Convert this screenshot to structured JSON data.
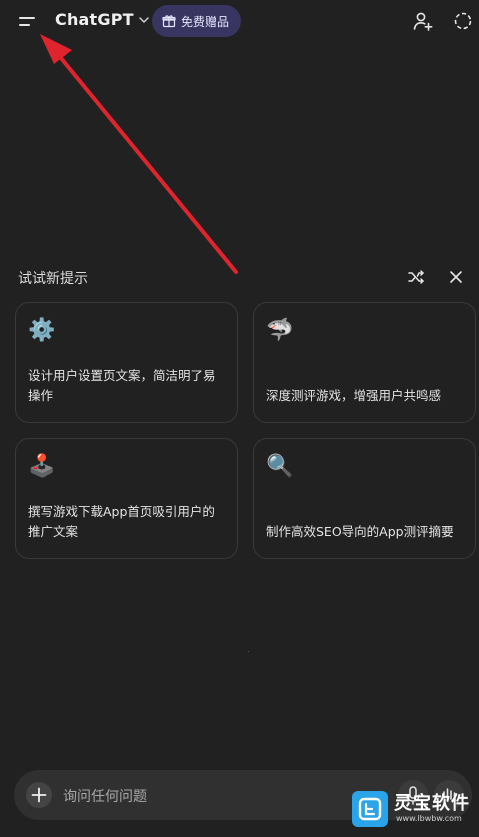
{
  "header": {
    "model_name": "ChatGPT",
    "gift_label": "免费赠品"
  },
  "suggestions": {
    "title": "试试新提示",
    "cards": [
      {
        "icon": "⚙️",
        "text": "设计用户设置页文案，简洁明了易操作"
      },
      {
        "icon": "🦈",
        "text": "深度测评游戏，增强用户共鸣感"
      },
      {
        "icon": "🕹️",
        "text": "撰写游戏下载App首页吸引用户的推广文案"
      },
      {
        "icon": "🔍",
        "text": "制作高效SEO导向的App测评摘要"
      }
    ]
  },
  "composer": {
    "placeholder": "询问任何问题"
  },
  "watermark": {
    "text": "灵宝软件",
    "sub": "www.lbwbw.com"
  },
  "colors": {
    "background": "#212121",
    "pill": "#383660",
    "annotation_arrow": "#e0242e"
  }
}
